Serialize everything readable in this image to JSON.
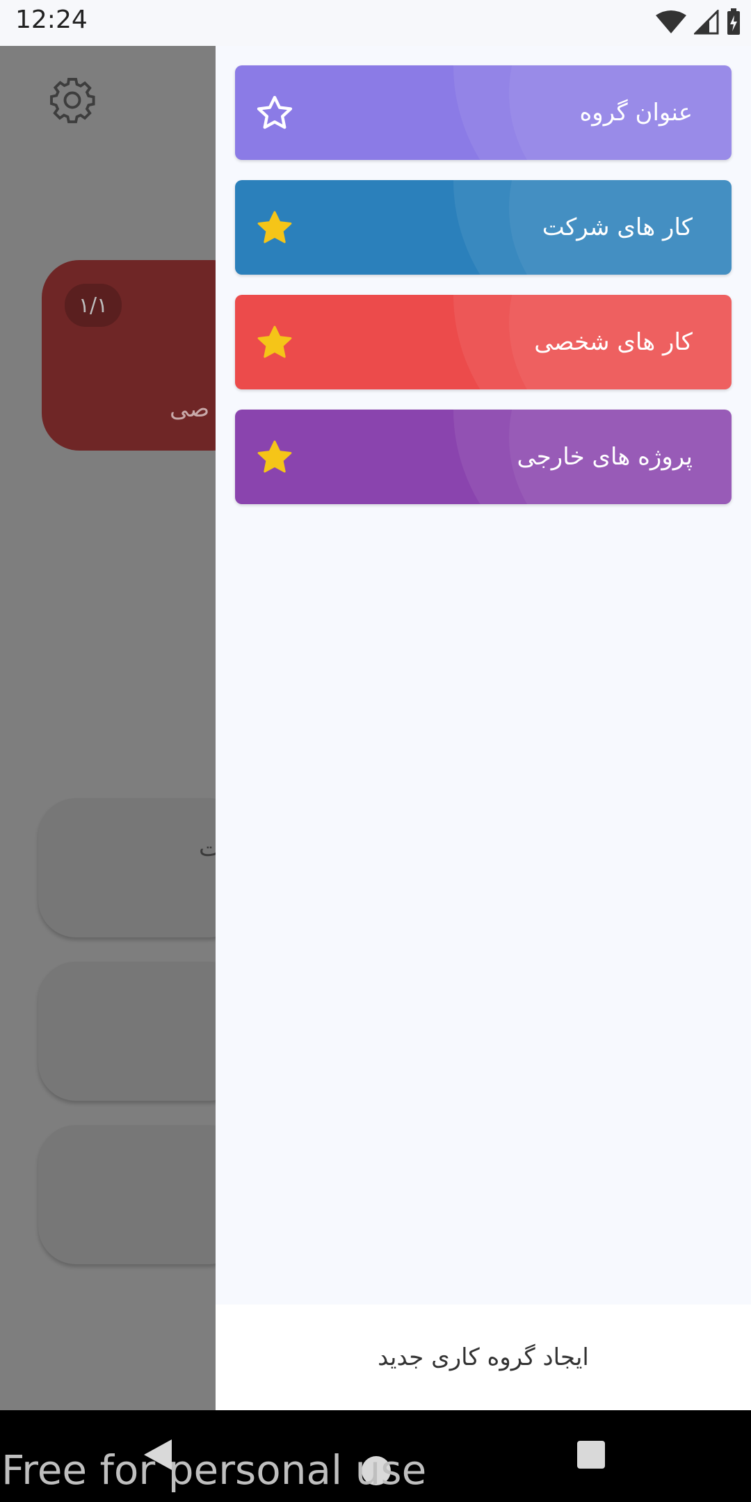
{
  "status_bar": {
    "time": "12:24",
    "icons": [
      "wifi-icon",
      "cell-signal-icon",
      "battery-charging-icon"
    ]
  },
  "background": {
    "badge": "۱/۱",
    "fragment_1": "صی",
    "fragment_2": "ت"
  },
  "drawer": {
    "groups": [
      {
        "label": "عنوان گروه",
        "color": "#8b7be6",
        "star": "outline"
      },
      {
        "label": "کار های شرکت",
        "color": "#2b80bb",
        "star": "filled"
      },
      {
        "label": "کار های شخصی",
        "color": "#ec4b4b",
        "star": "filled"
      },
      {
        "label": "پروژه های خارجی",
        "color": "#8a44ae",
        "star": "filled"
      }
    ],
    "create_button": "ایجاد گروه کاری جدید"
  },
  "colors": {
    "star_yellow": "#f5c518",
    "drawer_bg": "#f7f9fe"
  },
  "watermark": "Free for personal use"
}
